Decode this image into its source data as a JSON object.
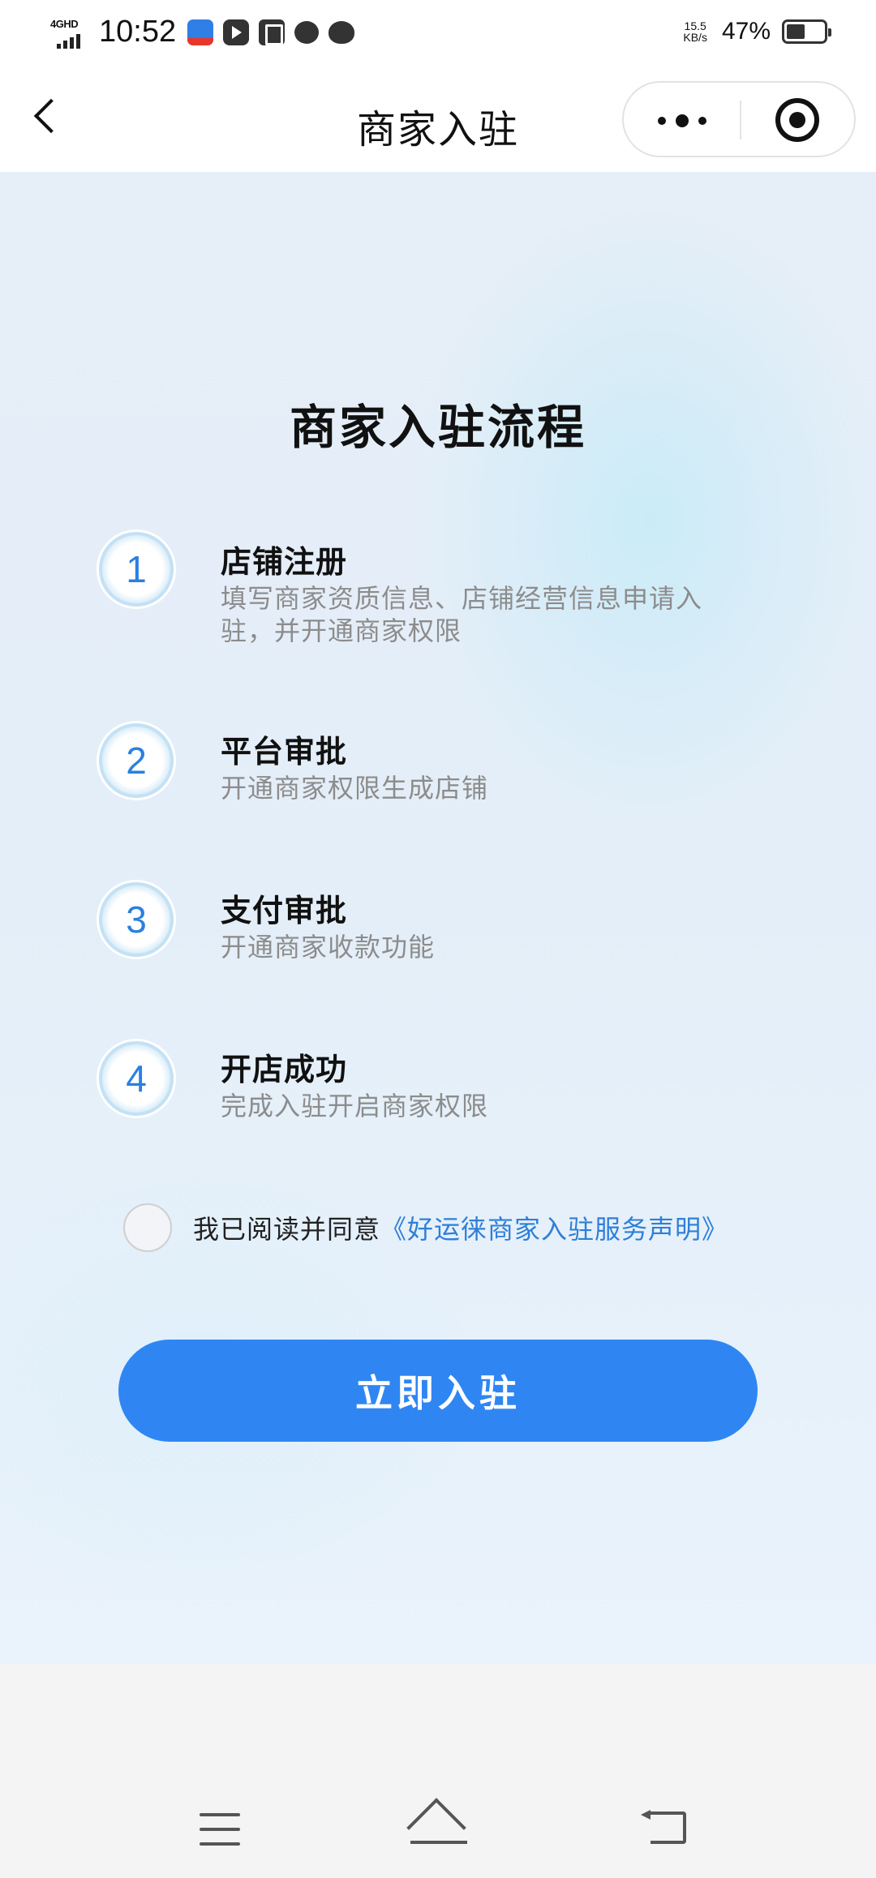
{
  "status_bar": {
    "network_type": "4GHD",
    "time": "10:52",
    "net_speed_value": "15.5",
    "net_speed_unit": "KB/s",
    "battery_text": "47%",
    "battery_level": 0.47
  },
  "nav": {
    "title": "商家入驻"
  },
  "main": {
    "title": "商家入驻流程",
    "steps": [
      {
        "number": "1",
        "title": "店铺注册",
        "desc": "填写商家资质信息、店铺经营信息申请入驻，并开通商家权限"
      },
      {
        "number": "2",
        "title": "平台审批",
        "desc": "开通商家权限生成店铺"
      },
      {
        "number": "3",
        "title": "支付审批",
        "desc": "开通商家收款功能"
      },
      {
        "number": "4",
        "title": "开店成功",
        "desc": "完成入驻开启商家权限"
      }
    ],
    "agreement_text": "我已阅读并同意",
    "agreement_link": "《好运徕商家入驻服务声明》",
    "join_button": "立即入驻"
  },
  "colors": {
    "accent": "#2f86f3",
    "link": "#2e7fd8",
    "step_number": "#2a80e0"
  }
}
